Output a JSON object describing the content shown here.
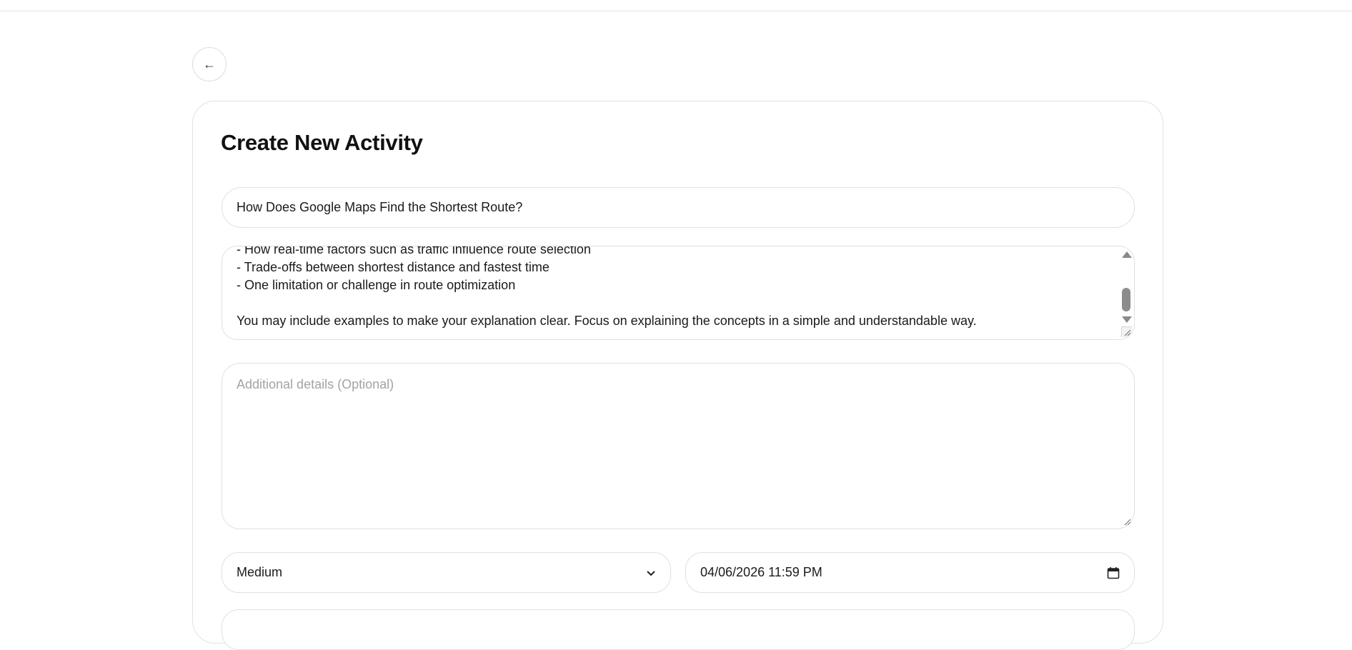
{
  "nav": {
    "back_label": "←"
  },
  "form": {
    "title": "Create New Activity",
    "activity_title_value": "How Does Google Maps Find the Shortest Route?",
    "description_value": "- How real-time factors such as traffic influence route selection\n- Trade-offs between shortest distance and fastest time\n- One limitation or challenge in route optimization\n\nYou may include examples to make your explanation clear. Focus on explaining the concepts in a simple and understandable way.",
    "details_placeholder": "Additional details (Optional)",
    "difficulty_value": "Medium",
    "due_datetime_value": "04/06/2026 11:59 PM"
  },
  "icons": {
    "back": "left-arrow-icon",
    "select": "chevron-down-icon",
    "date": "calendar-icon"
  }
}
